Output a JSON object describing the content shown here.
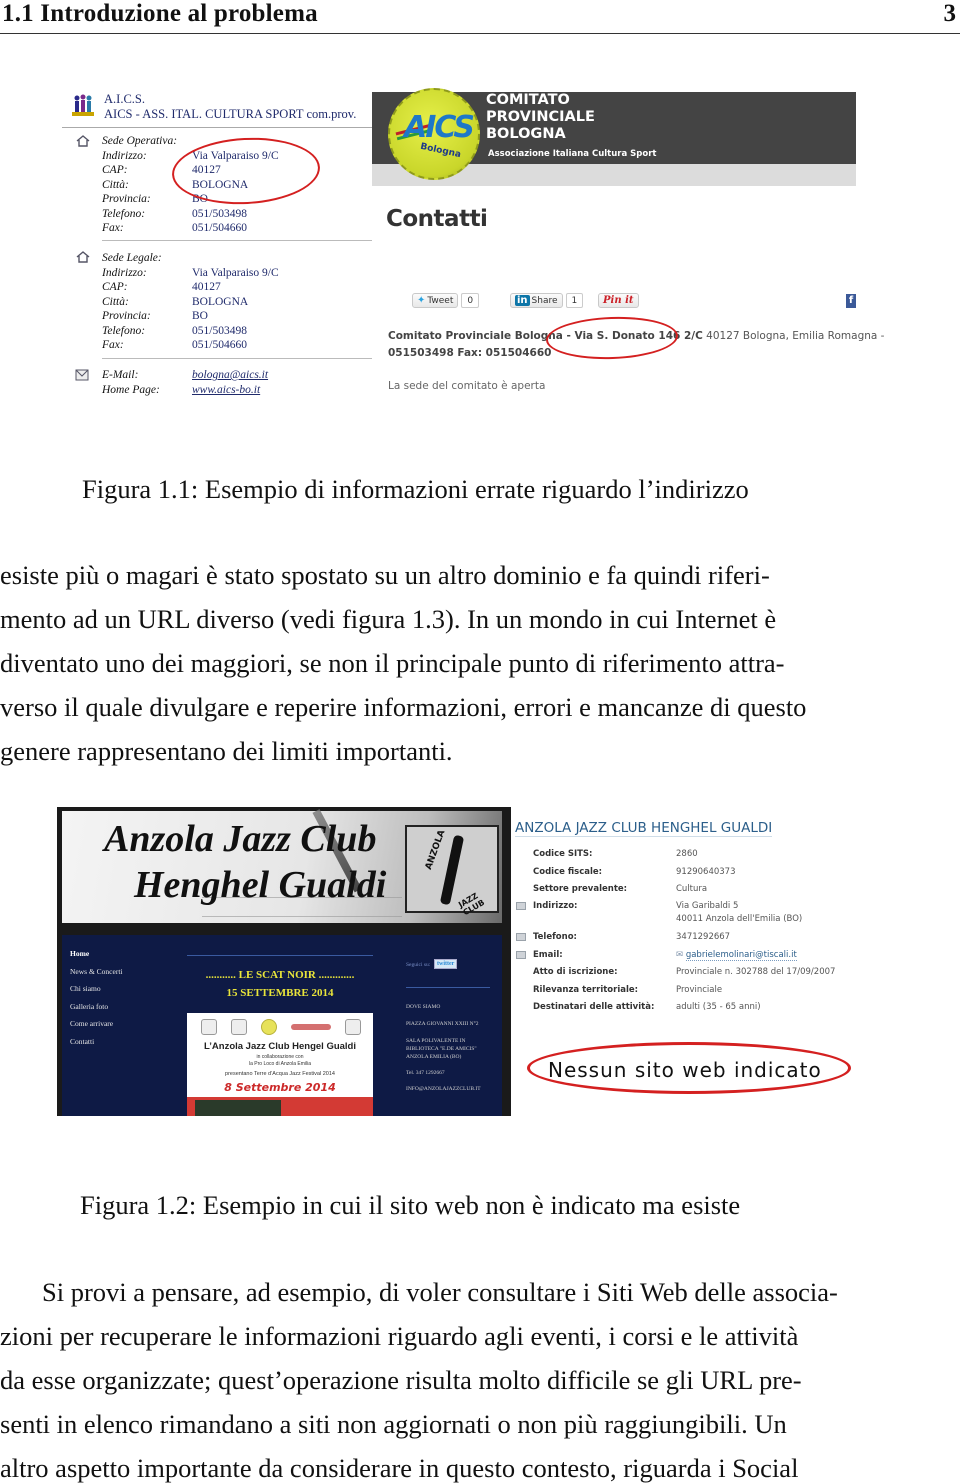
{
  "running_header": {
    "section_title": "1.1 Introduzione al problema",
    "page_number": "3"
  },
  "figure_1_1": {
    "caption": "Figura 1.1: Esempio di informazioni errate riguardo l’indirizzo",
    "left_screenshot": {
      "org_line1": "A.I.C.S.",
      "org_line2": "AICS - ASS. ITAL. CULTURA SPORT com.prov.",
      "sede_operativa": {
        "heading": "Sede Operativa:",
        "rows": [
          {
            "label": "Indirizzo:",
            "value": "Via Valparaiso 9/C"
          },
          {
            "label": "CAP:",
            "value": "40127"
          },
          {
            "label": "Città:",
            "value": "BOLOGNA"
          },
          {
            "label": "Provincia:",
            "value": "BO"
          },
          {
            "label": "Telefono:",
            "value": "051/503498"
          },
          {
            "label": "Fax:",
            "value": "051/504660"
          }
        ]
      },
      "sede_legale": {
        "heading": "Sede Legale:",
        "rows": [
          {
            "label": "Indirizzo:",
            "value": "Via Valparaiso 9/C"
          },
          {
            "label": "CAP:",
            "value": "40127"
          },
          {
            "label": "Città:",
            "value": "BOLOGNA"
          },
          {
            "label": "Provincia:",
            "value": "BO"
          },
          {
            "label": "Telefono:",
            "value": "051/503498"
          },
          {
            "label": "Fax:",
            "value": "051/504660"
          }
        ]
      },
      "contacts": [
        {
          "label": "E-Mail:",
          "value": "bologna@aics.it"
        },
        {
          "label": "Home Page:",
          "value": "www.aics-bo.it"
        }
      ]
    },
    "right_screenshot": {
      "logo_text": "AICS",
      "logo_sub": "Bologna",
      "banner_lines": [
        "COMITATO",
        "PROVINCIALE",
        "BOLOGNA"
      ],
      "banner_subtitle": "Associazione Italiana Cultura Sport",
      "page_heading": "Contatti",
      "social": {
        "tweet_label": "Tweet",
        "tweet_count": "0",
        "share_label": "Share",
        "share_count": "1",
        "pinit_label": "Pin it",
        "linkedin_logo": "in",
        "facebook_logo": "f"
      },
      "address_bold": "Comitato Provinciale Bologna - Via S. Donato 146 2/C",
      "address_rest": " 40127  Bologna, Emilia Romagna -",
      "phone_fax": "051503498 Fax: 051504660",
      "open_note": "La sede del comitato è aperta"
    }
  },
  "paragraph_1": [
    "esiste più o magari è stato spostato su un altro dominio e fa quindi riferi-",
    "mento ad un URL diverso (vedi figura 1.3). In un mondo in cui Internet è",
    "diventato uno dei maggiori, se non il principale punto di riferimento attra-",
    "verso il quale divulgare e reperire informazioni, errori e mancanze di questo",
    "genere rappresentano dei limiti importanti."
  ],
  "figure_1_2": {
    "caption": "Figura 1.2: Esempio in cui il sito web non è indicato ma esiste",
    "left_screenshot": {
      "title_line1": "Anzola Jazz Club",
      "title_line2": "Henghel Gualdi",
      "logo_text_top": "ANZOLA",
      "logo_text_bottom": "JAZZ CLUB",
      "nav": [
        "Home",
        "News & Concerti",
        "Chi siamo",
        "Galleria foto",
        "Come arrivare",
        "Contatti"
      ],
      "event_line1": "........... LE SCAT NOIR .............",
      "event_line2": "15 SETTEMBRE 2014",
      "poster": {
        "title": "L’Anzola Jazz Club Hengel Gualdi",
        "sub1": "in collaborazione con",
        "sub2": "la Pro Loco di Anzola Emilia",
        "sub3": "presentano Terre d’Acqua Jazz Festival 2014",
        "date": "8 Settembre 2014"
      },
      "follow_label": "Seguici su:",
      "twitter_label": "twitter",
      "sidebar": [
        "DOVE SIAMO",
        "PIAZZA GIOVANNI XXIII  N°2",
        "SALA POLIVALENTE IN",
        "BIBLIOTECA \"E.DE AMICIS\"",
        "ANZOLA EMILIA (BO)",
        "Tel. 347 1292667",
        "INFO@ANZOLAJAZZCLUB.IT"
      ]
    },
    "right_screenshot": {
      "title": "ANZOLA JAZZ CLUB HENGHEL GUALDI",
      "rows": [
        {
          "label": "Codice SITS:",
          "value": "2860"
        },
        {
          "label": "Codice fiscale:",
          "value": "91290640373"
        },
        {
          "label": "Settore prevalente:",
          "value": "Cultura"
        },
        {
          "label": "Indirizzo:",
          "value": "Via Garibaldi 5"
        },
        {
          "label": "",
          "value": "40011  Anzola dell'Emilia  (BO)"
        },
        {
          "label": "Telefono:",
          "value": "3471292667"
        },
        {
          "label": "Email:",
          "value": "gabrielemolinari@tiscali.it"
        },
        {
          "label": "Atto di iscrizione:",
          "value": "Provinciale n. 302788 del 17/09/2007"
        },
        {
          "label": "Rilevanza territoriale:",
          "value": "Provinciale"
        },
        {
          "label": "Destinatari delle attività:",
          "value": "adulti (35 - 65 anni)"
        }
      ],
      "annotation": "Nessun sito web indicato"
    }
  },
  "paragraph_2": [
    "Si provi a pensare, ad esempio, di voler consultare i Siti Web delle associa-",
    "zioni per recuperare le informazioni riguardo agli eventi, i corsi e le attività",
    "da esse organizzate; quest’operazione risulta molto difficile se gli URL pre-",
    "senti in elenco rimandano a siti non aggiornati o non più raggiungibili. Un",
    "altro aspetto importante da considerare in questo contesto, riguarda i Social"
  ],
  "colors": {
    "annotation_red": "#d42020",
    "aics_banner": "#444444",
    "jazz_navy": "#0e1a45",
    "event_yellow": "#e9e53a",
    "sits_title_blue": "#2b5e8a"
  }
}
